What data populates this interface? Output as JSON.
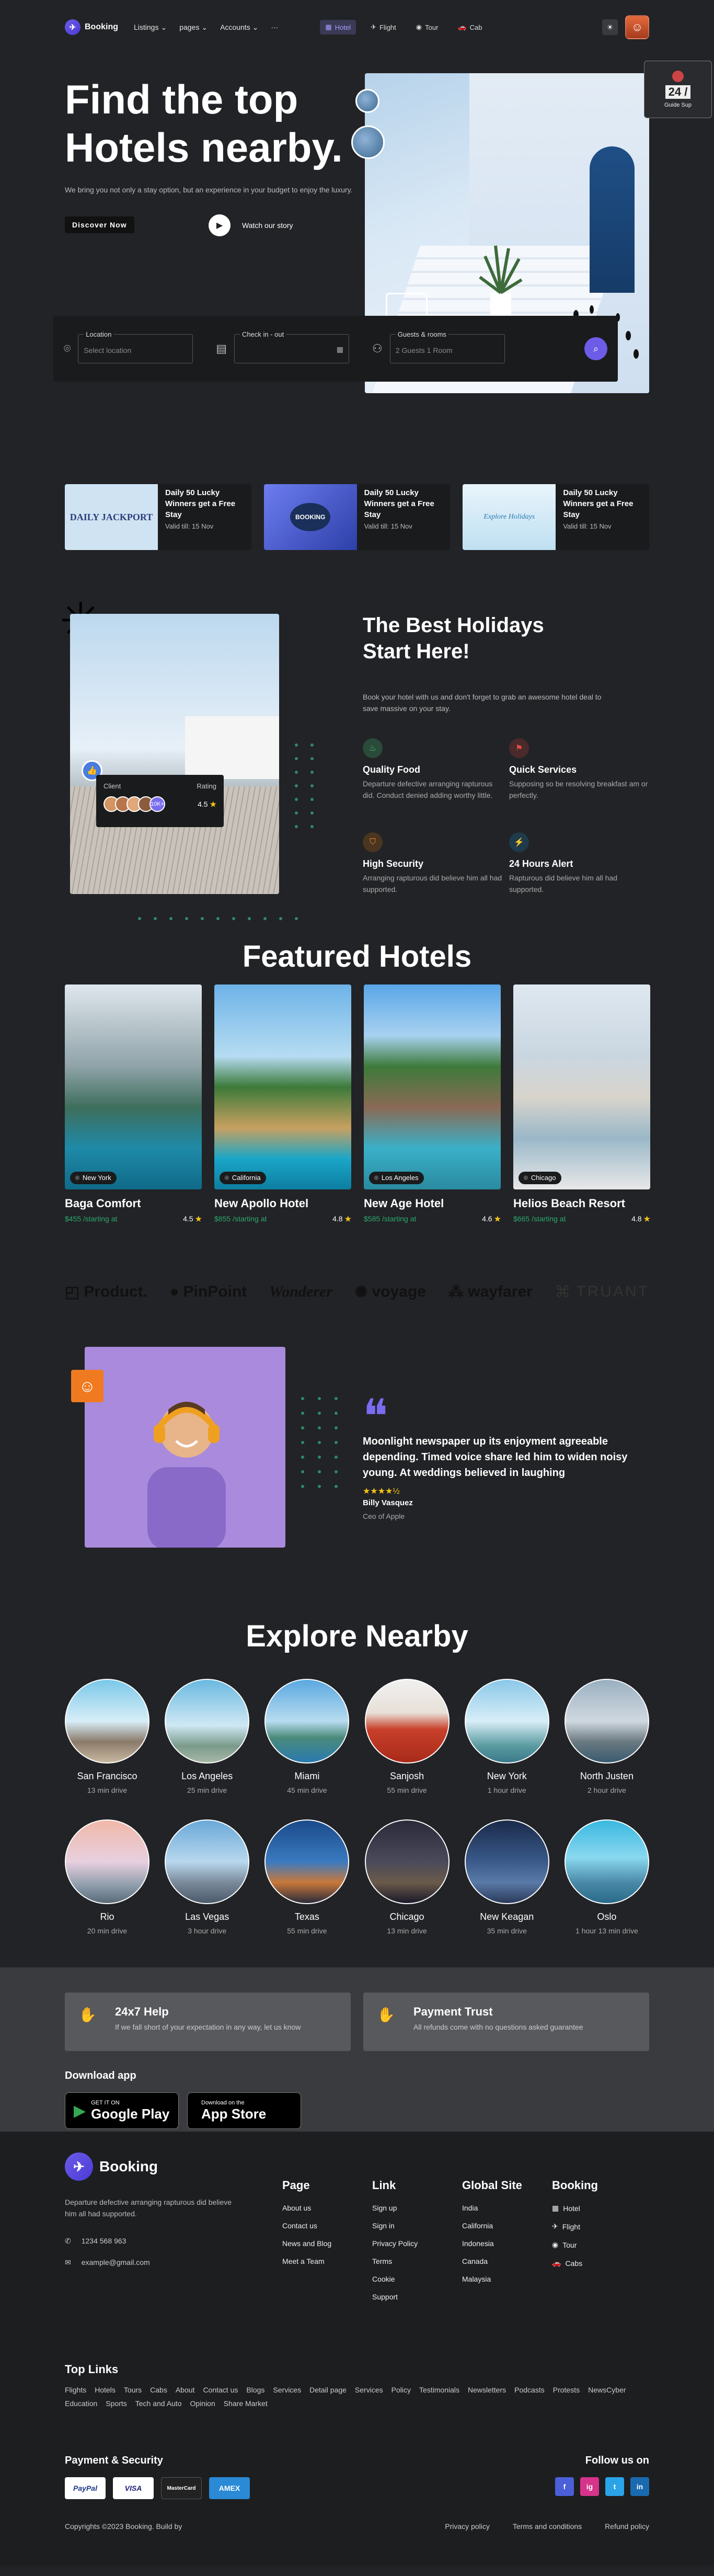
{
  "nav": {
    "brand": "Booking",
    "menu": [
      "Listings",
      "pages",
      "Accounts"
    ],
    "more": "···",
    "categories": [
      {
        "icon": "hotel-icon",
        "label": "Hotel",
        "active": true
      },
      {
        "icon": "flight-icon",
        "label": "Flight",
        "active": false
      },
      {
        "icon": "tour-icon",
        "label": "Tour",
        "active": false
      },
      {
        "icon": "cab-icon",
        "label": "Cab",
        "active": false
      }
    ]
  },
  "hero": {
    "title": "Find the top Hotels nearby.",
    "subtitle": "We bring you not only a stay option, but an experience in your budget to enjoy the luxury.",
    "cta": "Discover Now",
    "watch": "Watch our story",
    "guide_count": "24 /",
    "guide_label": "Guide Sup"
  },
  "search": {
    "location_label": "Location",
    "location_placeholder": "Select location",
    "checkin_label": "Check in - out",
    "checkin_value": "",
    "guests_label": "Guests & rooms",
    "guests_value": "2 Guests 1 Room"
  },
  "deals": [
    {
      "title": "Daily 50 Lucky Winners get a Free Stay",
      "valid": "Valid till: 15 Nov",
      "img_text": "DAILY JACKPORT"
    },
    {
      "title": "Daily 50 Lucky Winners get a Free Stay",
      "valid": "Valid till: 15 Nov",
      "img_text": "BOOKING"
    },
    {
      "title": "Daily 50 Lucky Winners get a Free Stay",
      "valid": "Valid till: 15 Nov",
      "img_text": "Explore Holidays"
    }
  ],
  "holidays": {
    "title": "The Best Holidays Start Here!",
    "subtitle": "Book your hotel with us and don't forget to grab an awesome hotel deal to save massive on your stay.",
    "client_label": "Client",
    "rating_label": "Rating",
    "more_count": "10K+",
    "rating": "4.5",
    "features": [
      {
        "icon": "food-icon",
        "title": "Quality Food",
        "desc": "Departure defective arranging rapturous did. Conduct denied adding worthy little.",
        "color": "#2a4a3a"
      },
      {
        "icon": "service-icon",
        "title": "Quick Services",
        "desc": "Supposing so be resolving breakfast am or perfectly.",
        "color": "#4a2a2a"
      },
      {
        "icon": "security-icon",
        "title": "High Security",
        "desc": "Arranging rapturous did believe him all had supported.",
        "color": "#4a3520"
      },
      {
        "icon": "alert-icon",
        "title": "24 Hours Alert",
        "desc": "Rapturous did believe him all had supported.",
        "color": "#1f3a4a"
      }
    ]
  },
  "featured": {
    "title": "Featured Hotels",
    "hotels": [
      {
        "name": "Baga Comfort",
        "location": "New York",
        "price": "$455 /starting at",
        "rating": "4.5"
      },
      {
        "name": "New Apollo Hotel",
        "location": "California",
        "price": "$855 /starting at",
        "rating": "4.8"
      },
      {
        "name": "New Age Hotel",
        "location": "Los Angeles",
        "price": "$585 /starting at",
        "rating": "4.6"
      },
      {
        "name": "Helios Beach Resort",
        "location": "Chicago",
        "price": "$665 /starting at",
        "rating": "4.8"
      }
    ]
  },
  "brands": [
    "Product.",
    "PinPoint",
    "Wonderer",
    "voyage",
    "wayfarer",
    "TRUANT"
  ],
  "testimonial": {
    "text": "Moonlight newspaper up its enjoyment agreeable depending. Timed voice share led him to widen noisy young. At weddings believed in laughing",
    "name": "Billy Vasquez",
    "role": "Ceo of Apple",
    "stars": "★★★★½"
  },
  "explore": {
    "title": "Explore Nearby",
    "cities": [
      {
        "name": "San Francisco",
        "drive": "13 min drive"
      },
      {
        "name": "Los Angeles",
        "drive": "25 min drive"
      },
      {
        "name": "Miami",
        "drive": "45 min drive"
      },
      {
        "name": "Sanjosh",
        "drive": "55 min drive"
      },
      {
        "name": "New York",
        "drive": "1 hour drive"
      },
      {
        "name": "North Justen",
        "drive": "2 hour drive"
      },
      {
        "name": "Rio",
        "drive": "20 min drive"
      },
      {
        "name": "Las Vegas",
        "drive": "3 hour drive"
      },
      {
        "name": "Texas",
        "drive": "55 min drive"
      },
      {
        "name": "Chicago",
        "drive": "13 min drive"
      },
      {
        "name": "New Keagan",
        "drive": "35 min drive"
      },
      {
        "name": "Oslo",
        "drive": "1 hour 13 min drive"
      }
    ]
  },
  "help": [
    {
      "title": "24x7 Help",
      "desc": "If we fall short of your expectation in any way, let us know"
    },
    {
      "title": "Payment Trust",
      "desc": "All refunds come with no questions asked guarantee"
    }
  ],
  "download": {
    "title": "Download app",
    "google_small": "GET IT ON",
    "google_big": "Google Play",
    "apple_small": "Download on the",
    "apple_big": "App Store"
  },
  "footer": {
    "brand": "Booking",
    "desc": "Departure defective arranging rapturous did believe him all had supported.",
    "phone": "1234 568 963",
    "email": "example@gmail.com",
    "columns": [
      {
        "title": "Page",
        "links": [
          "About us",
          "Contact us",
          "News and Blog",
          "Meet a Team"
        ]
      },
      {
        "title": "Link",
        "links": [
          "Sign up",
          "Sign in",
          "Privacy Policy",
          "Terms",
          "Cookie",
          "Support"
        ]
      },
      {
        "title": "Global Site",
        "links": [
          "India",
          "California",
          "Indonesia",
          "Canada",
          "Malaysia"
        ]
      },
      {
        "title": "Booking",
        "links": [
          "Hotel",
          "Flight",
          "Tour",
          "Cabs"
        ]
      }
    ],
    "top_links_title": "Top Links",
    "top_links": [
      "Flights",
      "Hotels",
      "Tours",
      "Cabs",
      "About",
      "Contact us",
      "Blogs",
      "Services",
      "Detail page",
      "Services",
      "Policy",
      "Testimonials",
      "Newsletters",
      "Podcasts",
      "Protests",
      "NewsCyber",
      "Education",
      "Sports",
      "Tech and Auto",
      "Opinion",
      "Share Market"
    ],
    "payment_title": "Payment & Security",
    "payment_cards": [
      "PayPal",
      "VISA",
      "MasterCard",
      "AMEX"
    ],
    "follow_title": "Follow us on",
    "socials": [
      "f",
      "ig",
      "t",
      "in"
    ],
    "copyright": "Copyrights ©2023 Booking. Build by",
    "legal": [
      "Privacy policy",
      "Terms and conditions",
      "Refund policy"
    ]
  }
}
